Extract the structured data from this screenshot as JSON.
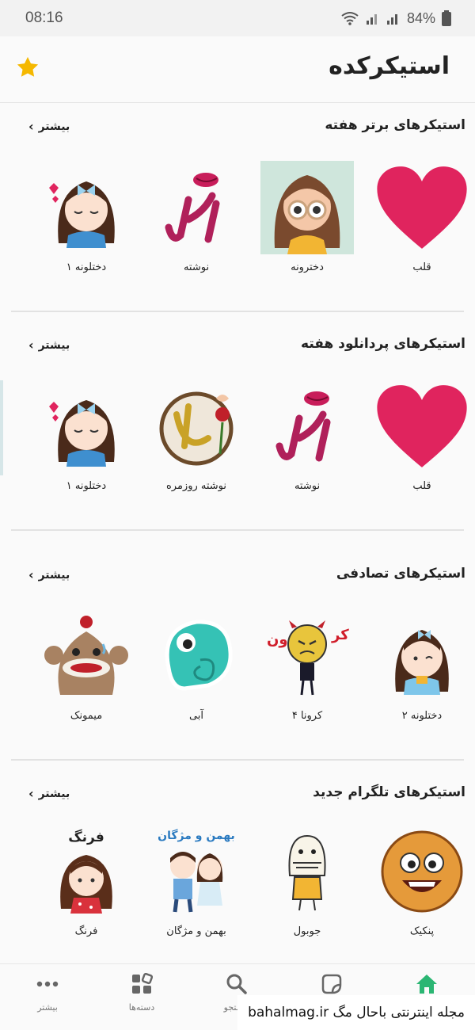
{
  "status_bar": {
    "time": "08:16",
    "battery": "84%"
  },
  "app_bar": {
    "title": "استیکرکده"
  },
  "sections": [
    {
      "title": "استیکرهای برتر هفته",
      "more": "بیشتر",
      "items": [
        {
          "label": "قلب",
          "icon": "heart-sticker"
        },
        {
          "label": "دخترونه",
          "icon": "girl-glasses-sticker"
        },
        {
          "label": "نوشته",
          "icon": "text-sticker"
        },
        {
          "label": "دختلونه ۱",
          "icon": "girl-bow-sticker"
        }
      ]
    },
    {
      "title": "استیکرهای پردانلود هفته",
      "more": "بیشتر",
      "items": [
        {
          "label": "قلب",
          "icon": "heart-sticker"
        },
        {
          "label": "نوشته",
          "icon": "text-sticker"
        },
        {
          "label": "نوشته روزمره",
          "icon": "salam-sticker"
        },
        {
          "label": "دختلونه ۱",
          "icon": "girl-bow-sticker"
        }
      ]
    },
    {
      "title": "استیکرهای تصادفی",
      "more": "بیشتر",
      "items": [
        {
          "label": "دختلونه ۲",
          "icon": "girl-sticker"
        },
        {
          "label": "کرونا ۴",
          "icon": "corona-sticker"
        },
        {
          "label": "آبی",
          "icon": "chameleon-sticker"
        },
        {
          "label": "میمونک",
          "icon": "monkey-sticker"
        }
      ]
    },
    {
      "title": "استیکرهای تلگرام جدید",
      "more": "بیشتر",
      "items": [
        {
          "label": "پنکیک",
          "icon": "pancake-sticker"
        },
        {
          "label": "جوبول",
          "icon": "jobol-sticker"
        },
        {
          "label": "بهمن و مژگان",
          "icon": "couple-sticker",
          "caption": "بهمن و مژگان"
        },
        {
          "label": "فرنگ",
          "icon": "farang-sticker",
          "caption": "فرنگ"
        }
      ]
    }
  ],
  "nav": [
    {
      "label": "بیشتر",
      "icon": "dots-icon"
    },
    {
      "label": "دسته‌ها",
      "icon": "categories-icon"
    },
    {
      "label": "جستجو",
      "icon": "search-icon"
    },
    {
      "label": "",
      "icon": "sticker-icon"
    },
    {
      "label": "",
      "icon": "home-icon"
    }
  ],
  "watermark": "مجله اینترنتی باحال مگ bahalmag.ir",
  "colors": {
    "accent": "#2bb673",
    "star": "#f5b800",
    "heart": "#e0245e"
  }
}
